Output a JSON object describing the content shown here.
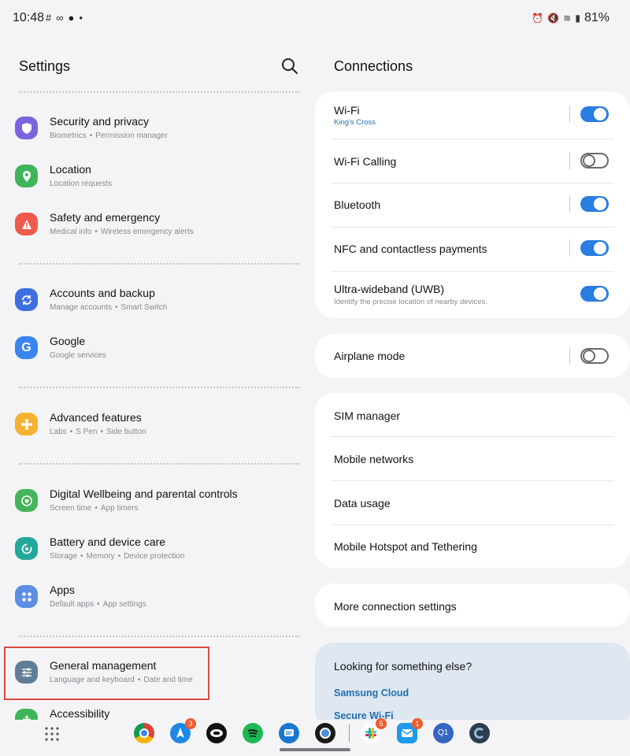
{
  "status_bar": {
    "time": "10:48",
    "left_icons": [
      "slack-icon",
      "link-icon",
      "chat-icon",
      "dot-icon"
    ],
    "right_icons": [
      "alarm-icon",
      "mute-icon",
      "wifi-icon",
      "signal-icon"
    ],
    "battery": "81%"
  },
  "settings": {
    "title": "Settings",
    "search_icon": "search-icon",
    "items": [
      {
        "label": "Security and privacy",
        "sub": [
          "Biometrics",
          "Permission manager"
        ],
        "icon": "shield-icon",
        "color": "#7a62e0"
      },
      {
        "label": "Location",
        "sub": [
          "Location requests"
        ],
        "icon": "location-pin-icon",
        "color": "#3fb55a"
      },
      {
        "label": "Safety and emergency",
        "sub": [
          "Medical info",
          "Wireless emergency alerts"
        ],
        "icon": "alert-icon",
        "color": "#ef5a4c"
      },
      {
        "label": "Accounts and backup",
        "sub": [
          "Manage accounts",
          "Smart Switch"
        ],
        "icon": "sync-icon",
        "color": "#3d6fe0"
      },
      {
        "label": "Google",
        "sub": [
          "Google services"
        ],
        "icon": "google-icon",
        "color": "#3a84ef"
      },
      {
        "label": "Advanced features",
        "sub": [
          "Labs",
          "S Pen",
          "Side button"
        ],
        "icon": "puzzle-icon",
        "color": "#f5b231"
      },
      {
        "label": "Digital Wellbeing and parental controls",
        "sub": [
          "Screen time",
          "App timers"
        ],
        "icon": "wellbeing-icon",
        "color": "#44b55a"
      },
      {
        "label": "Battery and device care",
        "sub": [
          "Storage",
          "Memory",
          "Device protection"
        ],
        "icon": "device-care-icon",
        "color": "#22a89a"
      },
      {
        "label": "Apps",
        "sub": [
          "Default apps",
          "App settings"
        ],
        "icon": "apps-icon",
        "color": "#5a8fe6"
      },
      {
        "label": "General management",
        "sub": [
          "Language and keyboard",
          "Date and time"
        ],
        "icon": "sliders-icon",
        "color": "#607d95"
      },
      {
        "label": "Accessibility",
        "sub": [],
        "icon": "accessibility-icon",
        "color": "#3fb55a"
      }
    ]
  },
  "connections": {
    "title": "Connections",
    "card1": [
      {
        "label": "Wi-Fi",
        "sub": "King's Cross",
        "sub_color": "#1f6fb3",
        "toggle": "on",
        "has_bar": true
      },
      {
        "label": "Wi-Fi Calling",
        "sub": "",
        "toggle": "off",
        "has_bar": true
      },
      {
        "label": "Bluetooth",
        "sub": "",
        "toggle": "on",
        "has_bar": true
      },
      {
        "label": "NFC and contactless payments",
        "sub": "",
        "toggle": "on",
        "has_bar": true
      },
      {
        "label": "Ultra-wideband (UWB)",
        "sub": "Identify the precise location of nearby devices.",
        "sub_color": "#8a8a8e",
        "toggle": "on",
        "has_bar": false
      }
    ],
    "airplane": {
      "label": "Airplane mode",
      "toggle": "off"
    },
    "card3": [
      "SIM manager",
      "Mobile networks",
      "Data usage",
      "Mobile Hotspot and Tethering"
    ],
    "more": "More connection settings",
    "suggestions": {
      "title": "Looking for something else?",
      "links": [
        "Samsung Cloud",
        "Secure Wi-Fi"
      ]
    }
  },
  "dock": {
    "apps": [
      {
        "icon": "chrome-icon",
        "color": "#db4437",
        "badge": ""
      },
      {
        "icon": "navigation-icon",
        "color": "#1e88e5",
        "badge": "3"
      },
      {
        "icon": "saturn-icon",
        "color": "#111111",
        "badge": ""
      },
      {
        "icon": "spotify-icon",
        "color": "#1db954",
        "badge": ""
      },
      {
        "icon": "messages-icon",
        "color": "#1976d2",
        "badge": ""
      },
      {
        "icon": "camera-icon",
        "color": "#1a1a1a",
        "badge": ""
      },
      {
        "icon": "slack-icon",
        "color": "#611f69",
        "badge": "5"
      },
      {
        "icon": "mail-icon",
        "color": "#1e9be8",
        "badge": "1"
      },
      {
        "icon": "q1-icon",
        "color": "#3466c2",
        "badge": ""
      },
      {
        "icon": "gallery-icon",
        "color": "#2b3d50",
        "badge": ""
      }
    ]
  }
}
